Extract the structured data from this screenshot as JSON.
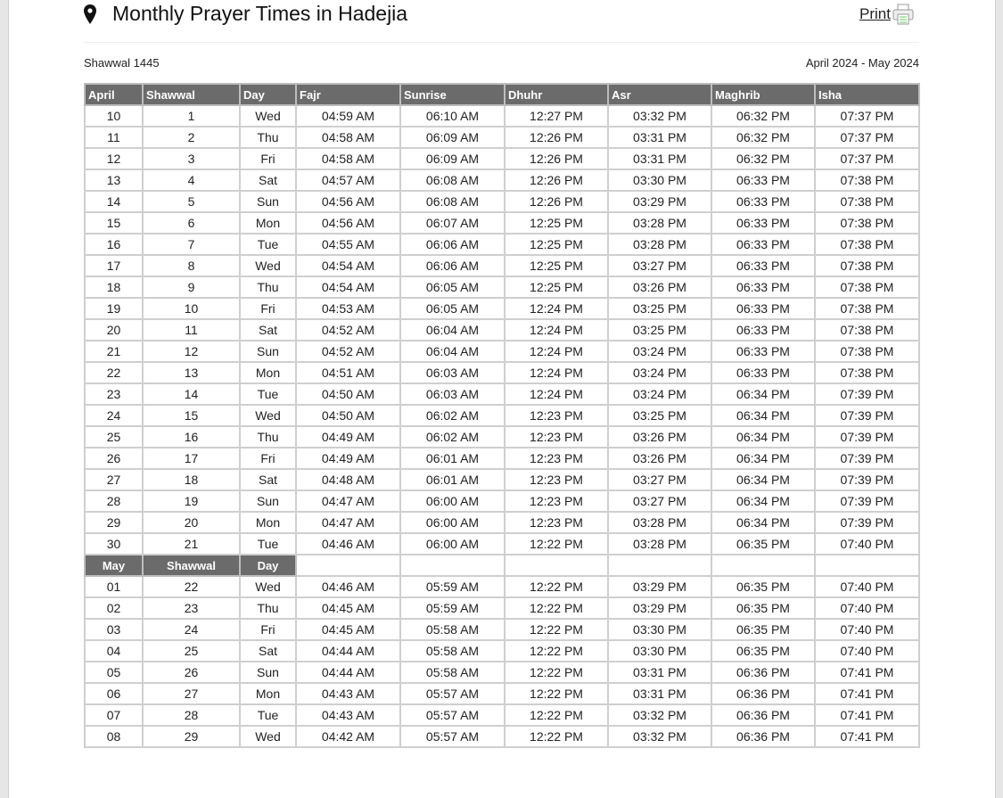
{
  "header": {
    "title": "Monthly Prayer Times in Hadejia",
    "print_label": "Print",
    "location_icon": "map-pin-icon",
    "print_icon": "printer-icon"
  },
  "subheader": {
    "hijri": "Shawwal 1445",
    "gregorian": "April 2024 - May 2024"
  },
  "table": {
    "columns": [
      "April",
      "Shawwal",
      "Day",
      "Fajr",
      "Sunrise",
      "Dhuhr",
      "Asr",
      "Maghrib",
      "Isha"
    ],
    "april_rows": [
      [
        "10",
        "1",
        "Wed",
        "04:59 AM",
        "06:10 AM",
        "12:27 PM",
        "03:32 PM",
        "06:32 PM",
        "07:37 PM"
      ],
      [
        "11",
        "2",
        "Thu",
        "04:58 AM",
        "06:09 AM",
        "12:26 PM",
        "03:31 PM",
        "06:32 PM",
        "07:37 PM"
      ],
      [
        "12",
        "3",
        "Fri",
        "04:58 AM",
        "06:09 AM",
        "12:26 PM",
        "03:31 PM",
        "06:32 PM",
        "07:37 PM"
      ],
      [
        "13",
        "4",
        "Sat",
        "04:57 AM",
        "06:08 AM",
        "12:26 PM",
        "03:30 PM",
        "06:33 PM",
        "07:38 PM"
      ],
      [
        "14",
        "5",
        "Sun",
        "04:56 AM",
        "06:08 AM",
        "12:26 PM",
        "03:29 PM",
        "06:33 PM",
        "07:38 PM"
      ],
      [
        "15",
        "6",
        "Mon",
        "04:56 AM",
        "06:07 AM",
        "12:25 PM",
        "03:28 PM",
        "06:33 PM",
        "07:38 PM"
      ],
      [
        "16",
        "7",
        "Tue",
        "04:55 AM",
        "06:06 AM",
        "12:25 PM",
        "03:28 PM",
        "06:33 PM",
        "07:38 PM"
      ],
      [
        "17",
        "8",
        "Wed",
        "04:54 AM",
        "06:06 AM",
        "12:25 PM",
        "03:27 PM",
        "06:33 PM",
        "07:38 PM"
      ],
      [
        "18",
        "9",
        "Thu",
        "04:54 AM",
        "06:05 AM",
        "12:25 PM",
        "03:26 PM",
        "06:33 PM",
        "07:38 PM"
      ],
      [
        "19",
        "10",
        "Fri",
        "04:53 AM",
        "06:05 AM",
        "12:24 PM",
        "03:25 PM",
        "06:33 PM",
        "07:38 PM"
      ],
      [
        "20",
        "11",
        "Sat",
        "04:52 AM",
        "06:04 AM",
        "12:24 PM",
        "03:25 PM",
        "06:33 PM",
        "07:38 PM"
      ],
      [
        "21",
        "12",
        "Sun",
        "04:52 AM",
        "06:04 AM",
        "12:24 PM",
        "03:24 PM",
        "06:33 PM",
        "07:38 PM"
      ],
      [
        "22",
        "13",
        "Mon",
        "04:51 AM",
        "06:03 AM",
        "12:24 PM",
        "03:24 PM",
        "06:33 PM",
        "07:38 PM"
      ],
      [
        "23",
        "14",
        "Tue",
        "04:50 AM",
        "06:03 AM",
        "12:24 PM",
        "03:24 PM",
        "06:34 PM",
        "07:39 PM"
      ],
      [
        "24",
        "15",
        "Wed",
        "04:50 AM",
        "06:02 AM",
        "12:23 PM",
        "03:25 PM",
        "06:34 PM",
        "07:39 PM"
      ],
      [
        "25",
        "16",
        "Thu",
        "04:49 AM",
        "06:02 AM",
        "12:23 PM",
        "03:26 PM",
        "06:34 PM",
        "07:39 PM"
      ],
      [
        "26",
        "17",
        "Fri",
        "04:49 AM",
        "06:01 AM",
        "12:23 PM",
        "03:26 PM",
        "06:34 PM",
        "07:39 PM"
      ],
      [
        "27",
        "18",
        "Sat",
        "04:48 AM",
        "06:01 AM",
        "12:23 PM",
        "03:27 PM",
        "06:34 PM",
        "07:39 PM"
      ],
      [
        "28",
        "19",
        "Sun",
        "04:47 AM",
        "06:00 AM",
        "12:23 PM",
        "03:27 PM",
        "06:34 PM",
        "07:39 PM"
      ],
      [
        "29",
        "20",
        "Mon",
        "04:47 AM",
        "06:00 AM",
        "12:23 PM",
        "03:28 PM",
        "06:34 PM",
        "07:39 PM"
      ],
      [
        "30",
        "21",
        "Tue",
        "04:46 AM",
        "06:00 AM",
        "12:22 PM",
        "03:28 PM",
        "06:35 PM",
        "07:40 PM"
      ]
    ],
    "may_header": [
      "May",
      "Shawwal",
      "Day"
    ],
    "may_rows": [
      [
        "01",
        "22",
        "Wed",
        "04:46 AM",
        "05:59 AM",
        "12:22 PM",
        "03:29 PM",
        "06:35 PM",
        "07:40 PM"
      ],
      [
        "02",
        "23",
        "Thu",
        "04:45 AM",
        "05:59 AM",
        "12:22 PM",
        "03:29 PM",
        "06:35 PM",
        "07:40 PM"
      ],
      [
        "03",
        "24",
        "Fri",
        "04:45 AM",
        "05:58 AM",
        "12:22 PM",
        "03:30 PM",
        "06:35 PM",
        "07:40 PM"
      ],
      [
        "04",
        "25",
        "Sat",
        "04:44 AM",
        "05:58 AM",
        "12:22 PM",
        "03:30 PM",
        "06:35 PM",
        "07:40 PM"
      ],
      [
        "05",
        "26",
        "Sun",
        "04:44 AM",
        "05:58 AM",
        "12:22 PM",
        "03:31 PM",
        "06:36 PM",
        "07:41 PM"
      ],
      [
        "06",
        "27",
        "Mon",
        "04:43 AM",
        "05:57 AM",
        "12:22 PM",
        "03:31 PM",
        "06:36 PM",
        "07:41 PM"
      ],
      [
        "07",
        "28",
        "Tue",
        "04:43 AM",
        "05:57 AM",
        "12:22 PM",
        "03:32 PM",
        "06:36 PM",
        "07:41 PM"
      ],
      [
        "08",
        "29",
        "Wed",
        "04:42 AM",
        "05:57 AM",
        "12:22 PM",
        "03:32 PM",
        "06:36 PM",
        "07:41 PM"
      ]
    ]
  },
  "colors": {
    "header_bg": "#6b6b6b",
    "border": "#cfcfcf"
  }
}
